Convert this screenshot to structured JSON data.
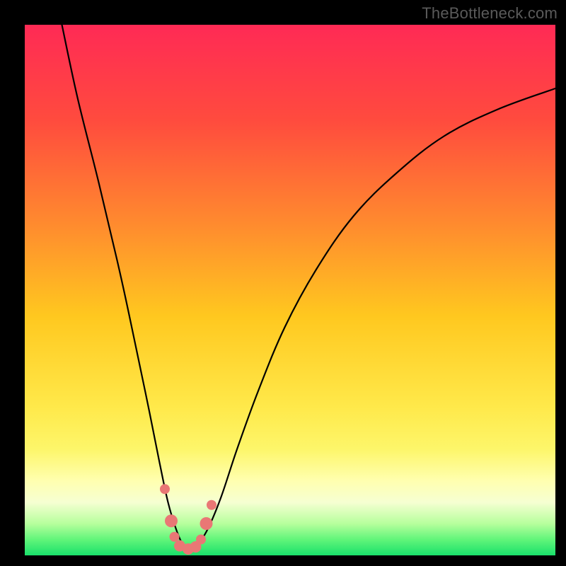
{
  "watermark": "TheBottleneck.com",
  "chart_data": {
    "type": "line",
    "title": "",
    "xlabel": "",
    "ylabel": "",
    "xlim": [
      0,
      100
    ],
    "ylim": [
      0,
      100
    ],
    "gradient_stops": [
      {
        "offset": 0,
        "color": "#ff2a55"
      },
      {
        "offset": 0.18,
        "color": "#ff4b3e"
      },
      {
        "offset": 0.38,
        "color": "#ff8c2e"
      },
      {
        "offset": 0.55,
        "color": "#ffc81f"
      },
      {
        "offset": 0.72,
        "color": "#ffe94a"
      },
      {
        "offset": 0.8,
        "color": "#fdf66a"
      },
      {
        "offset": 0.86,
        "color": "#ffffb0"
      },
      {
        "offset": 0.9,
        "color": "#f6ffd2"
      },
      {
        "offset": 0.94,
        "color": "#b7ff9d"
      },
      {
        "offset": 0.97,
        "color": "#61f57a"
      },
      {
        "offset": 1.0,
        "color": "#19e06a"
      }
    ],
    "series": [
      {
        "name": "bottleneck-curve",
        "x": [
          7.0,
          10.0,
          14.0,
          18.0,
          21.0,
          23.5,
          25.5,
          27.0,
          28.5,
          29.8,
          31.0,
          32.5,
          34.5,
          37.0,
          40.0,
          44.0,
          49.0,
          55.0,
          62.0,
          70.0,
          79.0,
          89.0,
          100.0
        ],
        "y": [
          100.0,
          86.0,
          70.0,
          53.0,
          39.0,
          27.0,
          17.0,
          10.0,
          5.0,
          2.0,
          1.0,
          2.0,
          5.0,
          11.0,
          20.0,
          31.0,
          43.0,
          54.0,
          64.0,
          72.0,
          79.0,
          84.0,
          88.0
        ]
      }
    ],
    "markers": [
      {
        "x": 26.4,
        "y": 12.5,
        "r": 7
      },
      {
        "x": 27.6,
        "y": 6.5,
        "r": 9
      },
      {
        "x": 28.2,
        "y": 3.5,
        "r": 7
      },
      {
        "x": 29.2,
        "y": 1.8,
        "r": 8
      },
      {
        "x": 30.8,
        "y": 1.2,
        "r": 8
      },
      {
        "x": 32.2,
        "y": 1.6,
        "r": 8
      },
      {
        "x": 33.2,
        "y": 3.0,
        "r": 7
      },
      {
        "x": 34.2,
        "y": 6.0,
        "r": 9
      },
      {
        "x": 35.2,
        "y": 9.5,
        "r": 7
      }
    ],
    "marker_color": "#e97775"
  }
}
